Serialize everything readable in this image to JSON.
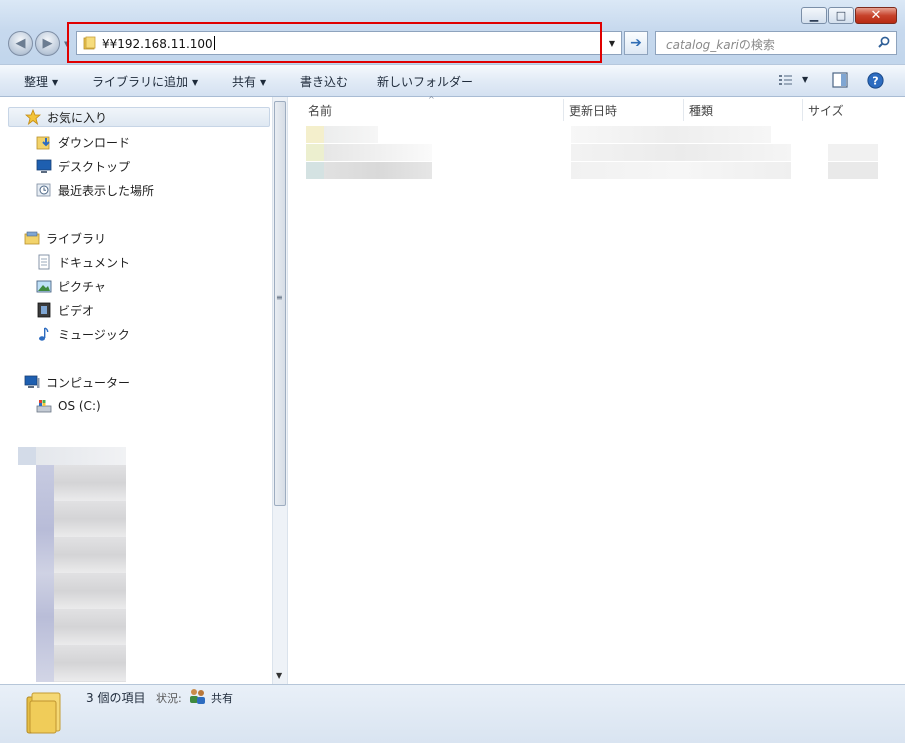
{
  "window": {
    "caption_buttons": {
      "minimize": "▭",
      "maximize": "□",
      "close": "✕"
    }
  },
  "address_bar": {
    "path": "¥¥192.168.11.100"
  },
  "search": {
    "placeholder_italic": "catalog_kari",
    "placeholder_suffix": "の検索"
  },
  "toolbar": {
    "organize": "整理",
    "add_to_library": "ライブラリに追加",
    "share": "共有",
    "burn": "書き込む",
    "new_folder": "新しいフォルダー"
  },
  "nav_pane": {
    "favorites": "お気に入り",
    "downloads": "ダウンロード",
    "desktop": "デスクトップ",
    "recent": "最近表示した場所",
    "libraries": "ライブラリ",
    "documents": "ドキュメント",
    "pictures": "ピクチャ",
    "videos": "ビデオ",
    "music": "ミュージック",
    "computer": "コンピューター",
    "drive_c": "OS (C:)"
  },
  "file_list": {
    "columns": [
      "名前",
      "更新日時",
      "種類",
      "サイズ"
    ]
  },
  "status": {
    "count": "3 個の項目",
    "state_label": "状況:",
    "state_value": "共有"
  },
  "colors": {
    "highlight_box": "#e00000",
    "window_frame": "#c2d6ec"
  }
}
